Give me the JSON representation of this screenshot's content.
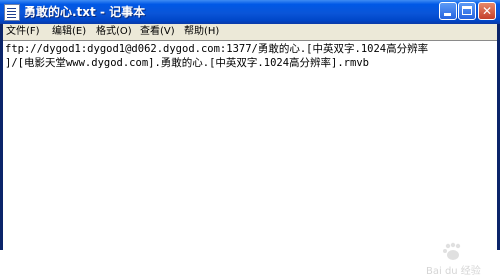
{
  "window": {
    "title": "勇敢的心.txt - 记事本"
  },
  "title_buttons": {
    "close_glyph": "✕"
  },
  "menu": {
    "items": [
      {
        "label": "文件(F)"
      },
      {
        "label": "编辑(E)"
      },
      {
        "label": "格式(O)"
      },
      {
        "label": "查看(V)"
      },
      {
        "label": "帮助(H)"
      }
    ]
  },
  "editor": {
    "lines": [
      "ftp://dygod1:dygod1@d062.dygod.com:1377/勇敢的心.[中英双字.1024高分辨率",
      "]/[电影天堂www.dygod.com].勇敢的心.[中英双字.1024高分辨率].rmvb"
    ]
  },
  "watermark": {
    "text": "Bai du 经验"
  },
  "colors": {
    "titlebar": "#0a55d8",
    "menubar": "#ece9d8",
    "close_button": "#c4412b"
  },
  "icons": [
    "notepad-icon",
    "minimize-icon",
    "maximize-icon",
    "close-icon"
  ]
}
